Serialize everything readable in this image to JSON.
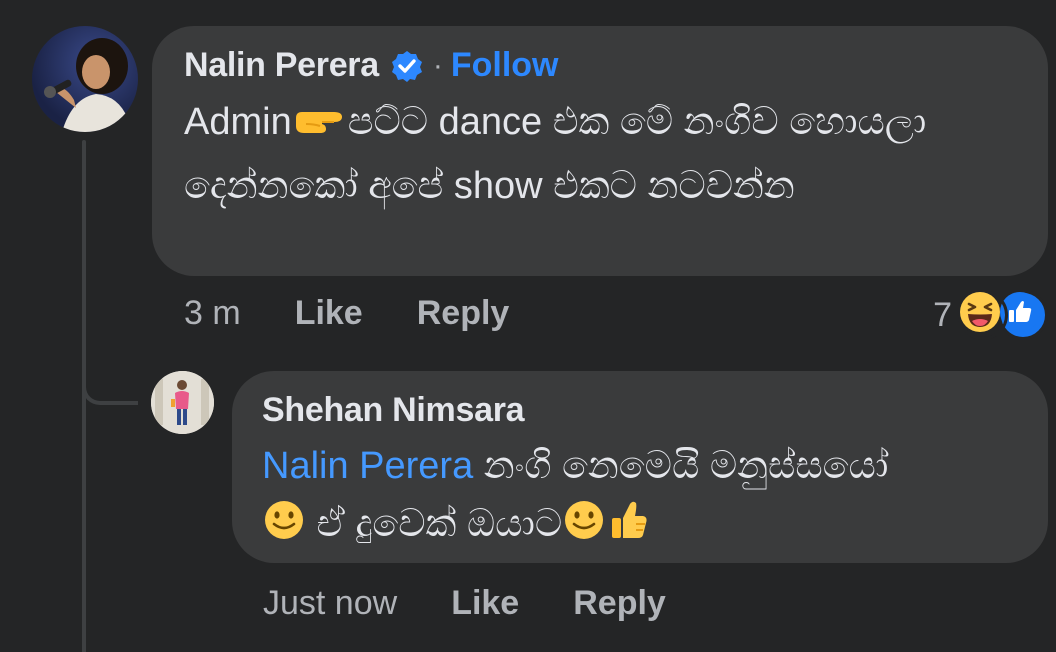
{
  "comment": {
    "author": "Nalin Perera",
    "separator": "·",
    "follow_label": "Follow",
    "text_before_emoji": "Admin",
    "text_after_emoji": "පට්ට dance එක මේ නංගිව හොයලා දෙන්නකෝ අපේ show එකට නටවන්න",
    "emoji": "point-right-emoji",
    "timestamp": "3 m",
    "like_label": "Like",
    "reply_label": "Reply",
    "reaction_count": "7",
    "reaction_icons": [
      "haha-reaction-icon",
      "like-reaction-icon"
    ]
  },
  "reply": {
    "author": "Shehan Nimsara",
    "mention": "Nalin Perera",
    "text_part1": " නංගි නෙමෙයි මනුස්සයෝ ",
    "text_part2": " ඒ දුවෙක් ඔයාට",
    "emojis": [
      "smile-emoji",
      "smile-emoji",
      "thumbs-up-emoji"
    ],
    "timestamp": "Just now",
    "like_label": "Like",
    "reply_label": "Reply"
  },
  "colors": {
    "background": "#242526",
    "bubble": "#3a3b3c",
    "text": "#e4e6eb",
    "secondary_text": "#b0b3b8",
    "link": "#2d88ff",
    "mention": "#4599ff"
  }
}
